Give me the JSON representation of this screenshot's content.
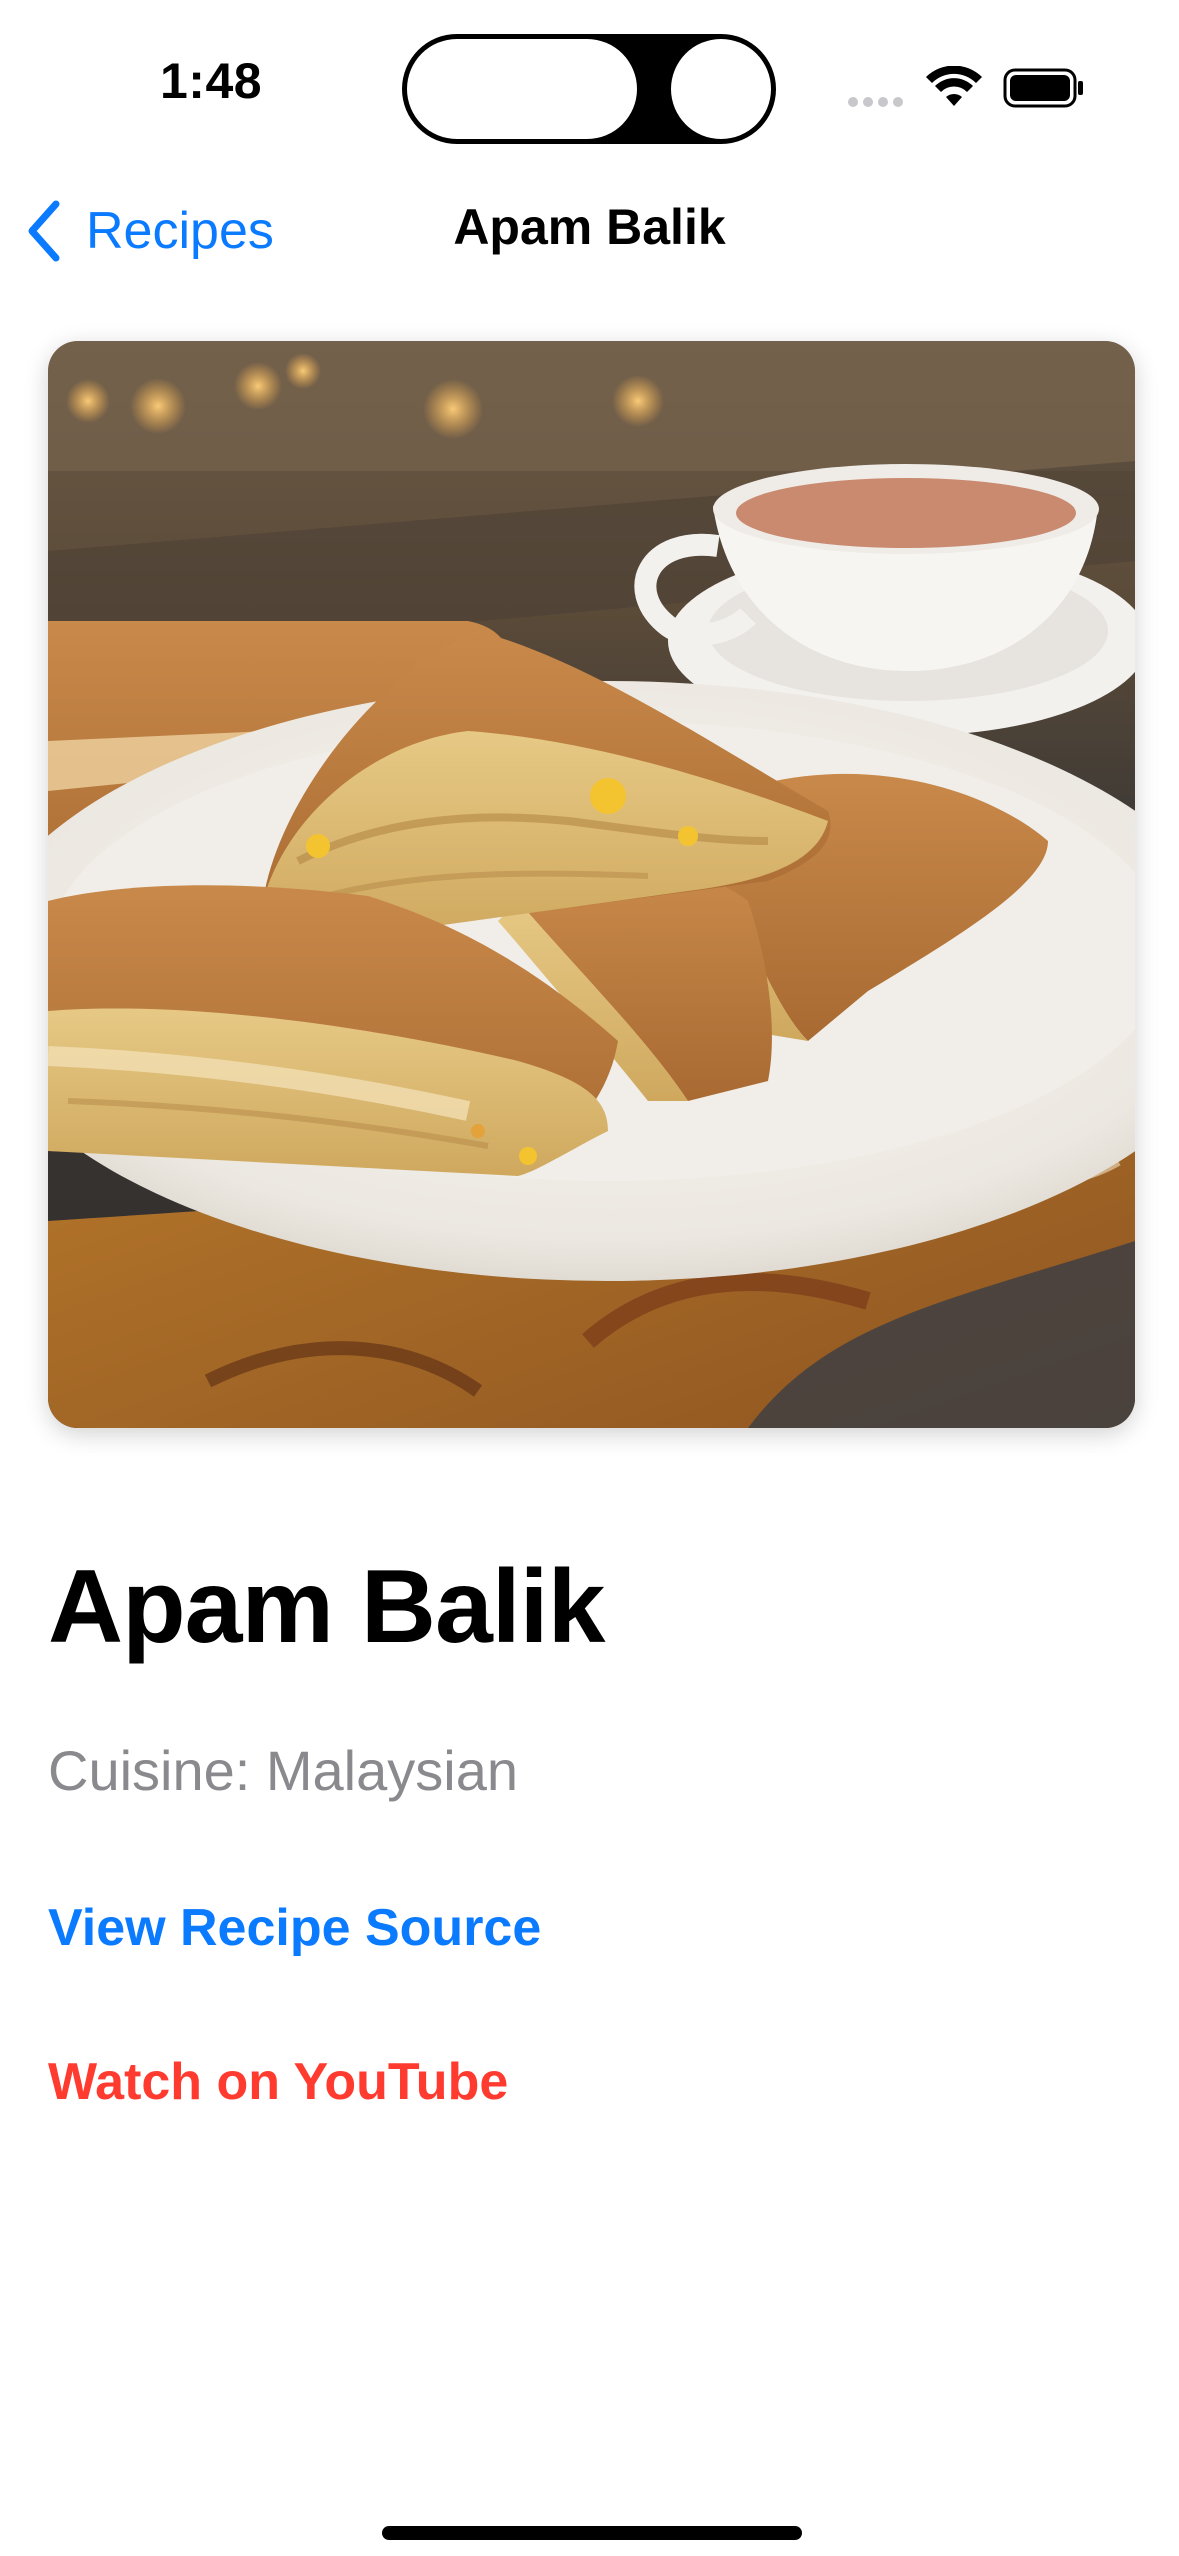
{
  "status_bar": {
    "time": "1:48"
  },
  "nav": {
    "back_label": "Recipes",
    "title": "Apam Balik",
    "accent_color": "#0a7aff"
  },
  "recipe": {
    "name": "Apam Balik",
    "cuisine": "Cuisine: Malaysian",
    "source_link_label": "View Recipe Source",
    "youtube_link_label": "Watch on YouTube",
    "source_link_color": "#0a7aff",
    "youtube_link_color": "#ff3b30"
  },
  "icons": {
    "back": "chevron-left-icon",
    "wifi": "wifi-icon",
    "battery": "battery-icon",
    "signal": "cellular-signal-icon"
  }
}
